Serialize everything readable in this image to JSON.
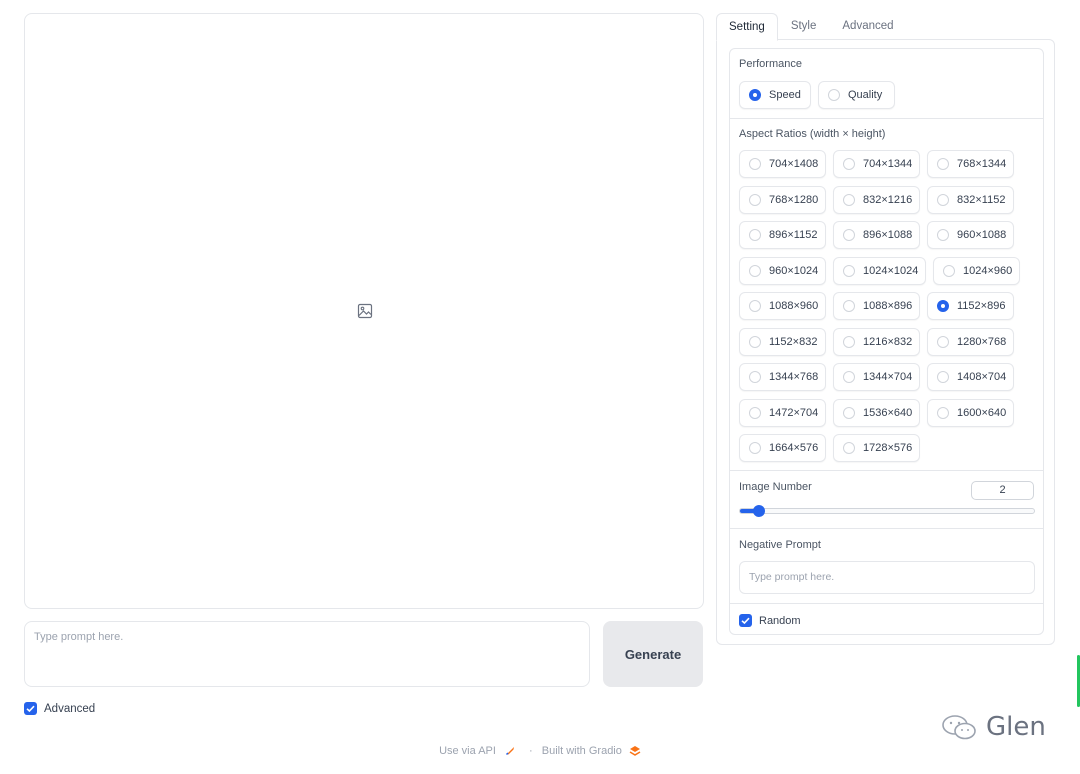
{
  "gallery": {
    "icon": "image-icon"
  },
  "prompt": {
    "placeholder": "Type prompt here."
  },
  "generate": {
    "label": "Generate"
  },
  "advanced_toggle": {
    "label": "Advanced",
    "checked": true
  },
  "footer": {
    "api": "Use via API",
    "separator": "·",
    "built": "Built with Gradio"
  },
  "watermark": {
    "text": "Glen"
  },
  "tabs": [
    {
      "label": "Setting",
      "active": true
    },
    {
      "label": "Style",
      "active": false
    },
    {
      "label": "Advanced",
      "active": false
    }
  ],
  "performance": {
    "label": "Performance",
    "options": [
      "Speed",
      "Quality"
    ],
    "selected": "Speed"
  },
  "aspect": {
    "label": "Aspect Ratios (width × height)",
    "options": [
      "704×1408",
      "704×1344",
      "768×1344",
      "768×1280",
      "832×1216",
      "832×1152",
      "896×1152",
      "896×1088",
      "960×1088",
      "960×1024",
      "1024×1024",
      "1024×960",
      "1088×960",
      "1088×896",
      "1152×896",
      "1152×832",
      "1216×832",
      "1280×768",
      "1344×768",
      "1344×704",
      "1408×704",
      "1472×704",
      "1536×640",
      "1600×640",
      "1664×576",
      "1728×576"
    ],
    "selected": "1152×896"
  },
  "image_number": {
    "label": "Image Number",
    "value": "2",
    "min": 1,
    "max": 32
  },
  "negative": {
    "label": "Negative Prompt",
    "placeholder": "Type prompt here."
  },
  "random": {
    "label": "Random",
    "checked": true
  },
  "colors": {
    "accent": "#2563eb",
    "border": "#e5e7eb",
    "button_bg": "#e8e9ec"
  }
}
